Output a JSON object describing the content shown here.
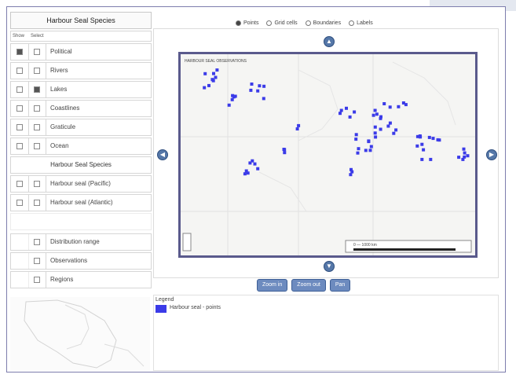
{
  "window": {
    "panel_title": "Harbour Seal Species"
  },
  "map_options": [
    {
      "label": "Points",
      "selected": true
    },
    {
      "label": "Grid cells",
      "selected": false
    },
    {
      "label": "Boundaries",
      "selected": false
    },
    {
      "label": "Labels",
      "selected": false
    }
  ],
  "layers": {
    "col_headers": [
      "Show",
      "Select"
    ],
    "rows": [
      {
        "label": "Political",
        "show": true,
        "select": false
      },
      {
        "label": "Rivers",
        "show": false,
        "select": false
      },
      {
        "label": "Lakes",
        "show": false,
        "select": true
      },
      {
        "label": "Coastlines",
        "show": false,
        "select": false
      },
      {
        "label": "Graticule",
        "show": false,
        "select": false
      },
      {
        "label": "Ocean",
        "show": false,
        "select": false
      }
    ],
    "section_title": "Harbour Seal Species",
    "species_rows": [
      {
        "label": "Harbour seal (Pacific)",
        "show": false,
        "select": false
      },
      {
        "label": "Harbour seal (Atlantic)",
        "show": false,
        "select": false
      }
    ],
    "extra_rows": [
      {
        "label": "Distribution range",
        "select": false
      },
      {
        "label": "Observations",
        "select": false
      },
      {
        "label": "Regions",
        "select": false
      }
    ]
  },
  "toolbar": {
    "buttons": [
      "Zoom in",
      "Zoom out",
      "Pan"
    ]
  },
  "legend": {
    "title": "Legend",
    "item_label": "Harbour seal - points",
    "swatch_color": "#3b3be8"
  },
  "map": {
    "header_text": "HARBOUR SEAL OBSERVATIONS",
    "scale_text": "0 — 1000 km"
  }
}
